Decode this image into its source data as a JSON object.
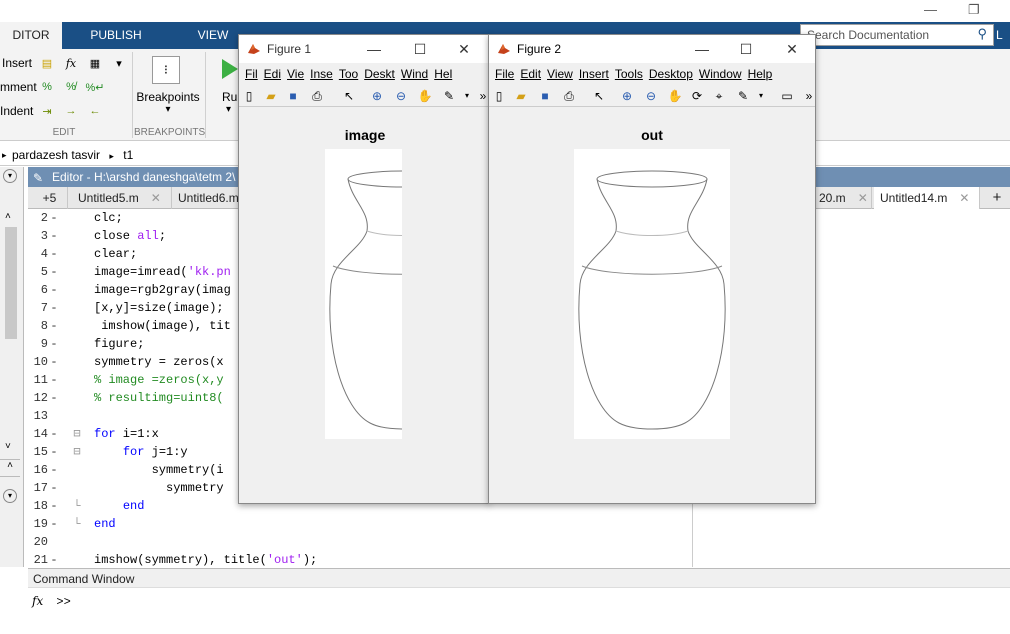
{
  "window": {
    "minimize_glyph": "—",
    "restore_glyph": "❐"
  },
  "ribbon_tabs": [
    {
      "label": "DITOR"
    },
    {
      "label": "PUBLISH"
    },
    {
      "label": "VIEW"
    }
  ],
  "search": {
    "placeholder": "Search Documentation",
    "user_initial": "L"
  },
  "ribbon": {
    "insert_label": "Insert",
    "comment_label": "mment",
    "indent_label": "Indent",
    "breakpoints_label": "Breakpoints",
    "run_label": "Run",
    "group_edit": "EDIT",
    "group_breakpoints": "BREAKPOINTS"
  },
  "breadcrumb": {
    "items": [
      "pardazesh tasvir",
      "t1"
    ],
    "separator": "▸"
  },
  "editor": {
    "header": "Editor - H:\\arshd daneshga\\tetm 2\\",
    "tabs": [
      {
        "label": "+5"
      },
      {
        "label": "Untitled5.m"
      },
      {
        "label": "Untitled6.m"
      },
      {
        "label": "20.m"
      },
      {
        "label": "Untitled14.m"
      }
    ],
    "add_tab": "+",
    "lines": [
      {
        "n": "2",
        "text": "clc;"
      },
      {
        "n": "3",
        "text": "close all;"
      },
      {
        "n": "4",
        "text": "clear;"
      },
      {
        "n": "5",
        "text": "image=imread('kk.pn"
      },
      {
        "n": "6",
        "text": "image=rgb2gray(imag"
      },
      {
        "n": "7",
        "text": "[x,y]=size(image);"
      },
      {
        "n": "8",
        "text": " imshow(image), tit"
      },
      {
        "n": "9",
        "text": "figure;"
      },
      {
        "n": "10",
        "text": "symmetry = zeros(x"
      },
      {
        "n": "11",
        "text": "% image =zeros(x,y"
      },
      {
        "n": "12",
        "text": "% resultimg=uint8("
      },
      {
        "n": "13",
        "text": ""
      },
      {
        "n": "14",
        "text": "for i=1:x"
      },
      {
        "n": "15",
        "text": "    for j=1:y"
      },
      {
        "n": "16",
        "text": "        symmetry(i"
      },
      {
        "n": "17",
        "text": "          symmetry"
      },
      {
        "n": "18",
        "text": "    end"
      },
      {
        "n": "19",
        "text": "end"
      },
      {
        "n": "20",
        "text": ""
      },
      {
        "n": "21",
        "text": "imshow(symmetry), title('out');"
      }
    ]
  },
  "command_window": {
    "title": "Command Window",
    "fx": "fx",
    "prompt": ">>"
  },
  "figure1": {
    "title": "Figure 1",
    "menus": [
      "Fil",
      "Edi",
      "Vie",
      "Inse",
      "Too",
      "Deskt",
      "Wind",
      "Hel"
    ],
    "axes_title": "image"
  },
  "figure2": {
    "title": "Figure 2",
    "menus": [
      "File",
      "Edit",
      "View",
      "Insert",
      "Tools",
      "Desktop",
      "Window",
      "Help"
    ],
    "axes_title": "out"
  },
  "colors": {
    "tabstrip": "#1a4f85",
    "editor_header": "#6f8fb3",
    "keyword": "#0000ff",
    "string": "#a020f0",
    "comment": "#228b22"
  }
}
